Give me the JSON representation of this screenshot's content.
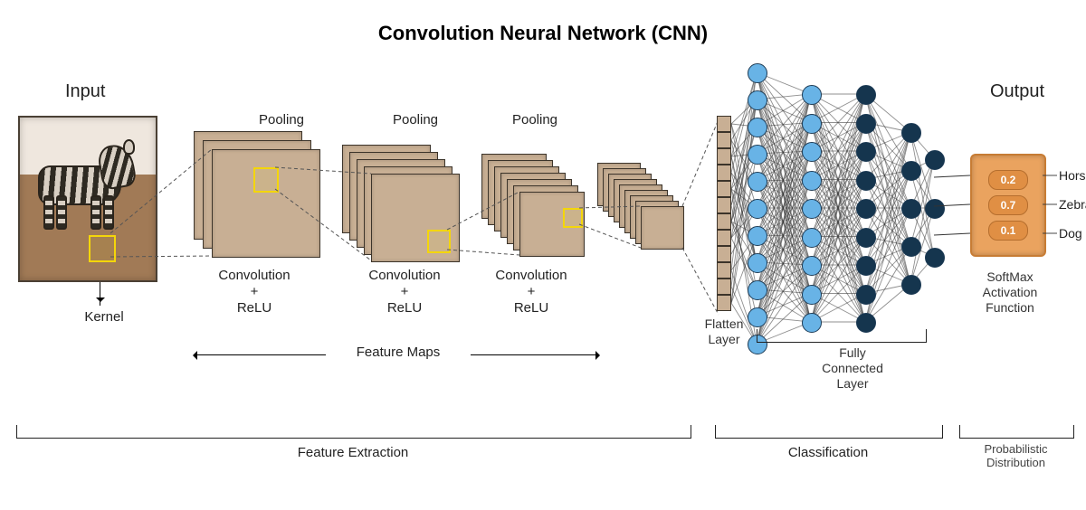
{
  "title": "Convolution Neural Network (CNN)",
  "input": {
    "heading": "Input",
    "kernel_label": "Kernel"
  },
  "stages": {
    "pooling_label": "Pooling",
    "conv_relu_label": "Convolution\n+\nReLU",
    "feature_maps_label": "Feature  Maps"
  },
  "flatten_label": "Flatten\nLayer",
  "fc_label": "Fully\nConnected\nLayer",
  "output": {
    "heading": "Output",
    "softmax_label": "SoftMax\nActivation\nFunction",
    "classes": [
      {
        "name": "Horse",
        "prob": "0.2"
      },
      {
        "name": "Zebra",
        "prob": "0.7"
      },
      {
        "name": "Dog",
        "prob": "0.1"
      }
    ]
  },
  "sections": {
    "feature_extraction": "Feature Extraction",
    "classification": "Classification",
    "prob_dist": "Probabilistic\nDistribution"
  }
}
